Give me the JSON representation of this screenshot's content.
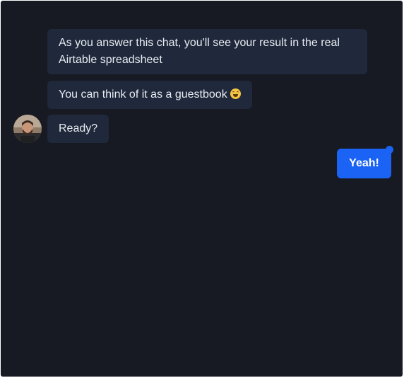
{
  "messages": {
    "bot": [
      "As you answer this chat, you'll see your result in the real Airtable spreadsheet",
      "You can think of it as a guestbook",
      "Ready?"
    ],
    "bot_emoji_icon": "laughing-tears-emoji",
    "user": "Yeah!"
  },
  "colors": {
    "background": "#181a23",
    "bot_bubble": "#1f293b",
    "bot_text": "#e8ebf1",
    "user_bubble": "#1a63f5",
    "user_text": "#ffffff"
  }
}
